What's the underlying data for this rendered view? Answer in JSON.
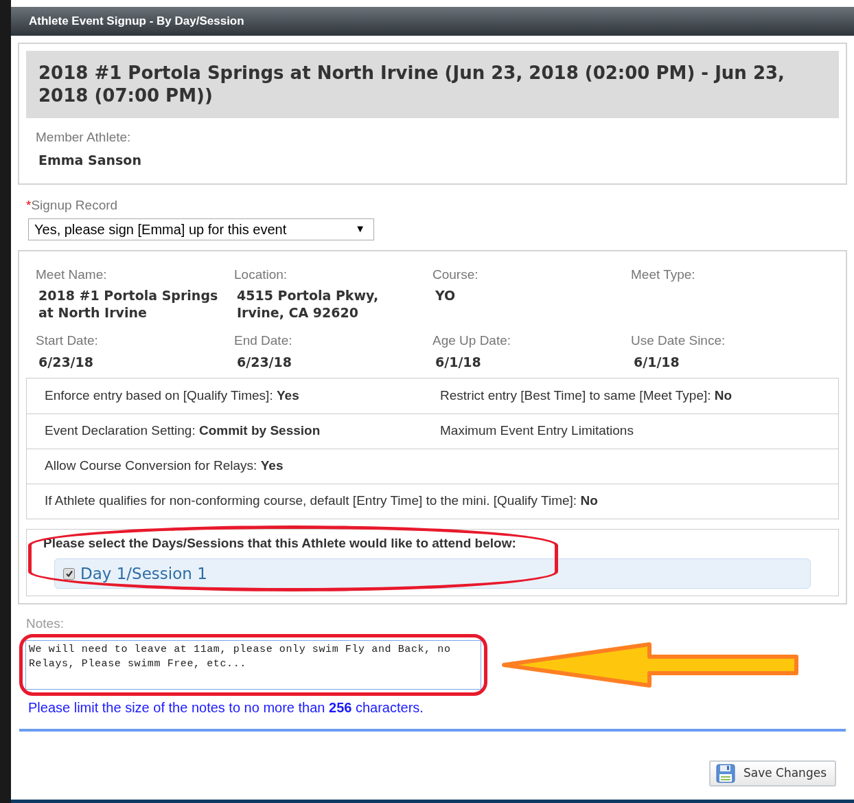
{
  "window": {
    "title": "Athlete Event Signup - By Day/Session"
  },
  "event_title": "2018 #1 Portola Springs at North Irvine (Jun 23, 2018 (02:00 PM) - Jun 23, 2018 (07:00 PM))",
  "member": {
    "label": "Member Athlete:",
    "value": "Emma Sanson"
  },
  "signup": {
    "required_mark": "*",
    "label": "Signup Record",
    "value": "Yes, please sign [Emma] up for this event",
    "caret": "▼"
  },
  "meet_info": [
    {
      "label": "Meet Name:",
      "value": "2018 #1 Portola Springs at North Irvine"
    },
    {
      "label": "Location:",
      "value": "4515 Portola Pkwy, Irvine, CA 92620"
    },
    {
      "label": "Course:",
      "value": "YO"
    },
    {
      "label": "Meet Type:"
    },
    {
      "label": "Start Date:",
      "value": "6/23/18"
    },
    {
      "label": "End Date:",
      "value": "6/23/18"
    },
    {
      "label": "Age Up Date:",
      "value": "6/1/18"
    },
    {
      "label": "Use Date Since:",
      "value": "6/1/18"
    }
  ],
  "settings": [
    [
      "Enforce entry based on [Qualify Times]: **Yes**",
      "Restrict entry [Best Time] to same [Meet Type]: **No**"
    ],
    [
      "Event Declaration Setting: **Commit by Session**",
      "Maximum Event Entry Limitations"
    ],
    [
      "Allow Course Conversion for Relays: **Yes**"
    ],
    [
      "If Athlete qualifies for non-conforming course, default [Entry Time] to the mini. [Qualify Time]: **No**"
    ]
  ],
  "sessions": {
    "prompt": "Please select the Days/Sessions that this Athlete would like to attend below:",
    "items": [
      {
        "label": "Day 1/Session 1",
        "checked": true
      }
    ]
  },
  "notes": {
    "label": "Notes:",
    "value": "We will need to leave at 11am, please only swim Fly and Back, no Relays, Please swimm Free, etc...",
    "hint": "Please limit the size of the notes to no more than **256** characters."
  },
  "save_button": "Save Changes"
}
